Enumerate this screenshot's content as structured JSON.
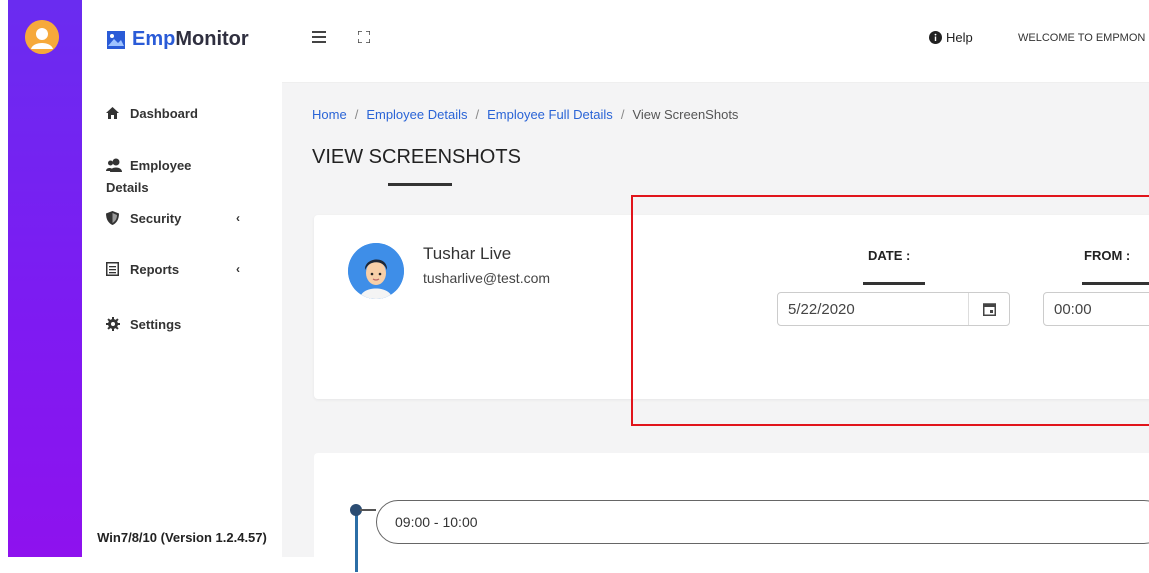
{
  "app": {
    "logo_part1": "Emp",
    "logo_part2": "Monitor"
  },
  "sidebar": {
    "items": [
      {
        "label": "Dashboard",
        "icon": "home-icon"
      },
      {
        "label_line1": "Employee",
        "label_line2": "Details",
        "icon": "users-icon"
      },
      {
        "label": "Security",
        "icon": "shield-icon",
        "chevron": "‹"
      },
      {
        "label": "Reports",
        "icon": "report-icon",
        "chevron": "‹"
      },
      {
        "label": "Settings",
        "icon": "gear-icon"
      }
    ],
    "version": "Win7/8/10 (Version 1.2.4.57)"
  },
  "topbar": {
    "help_label": "Help",
    "welcome_text": "WELCOME TO EMPMON"
  },
  "breadcrumb": {
    "items": [
      "Home",
      "Employee Details",
      "Employee Full Details"
    ],
    "current": "View ScreenShots",
    "separator": "/"
  },
  "page": {
    "title": "VIEW SCREENSHOTS"
  },
  "employee": {
    "name": "Tushar Live",
    "email": "tusharlive@test.com"
  },
  "filters": {
    "date_label": "DATE :",
    "date_value": "5/22/2020",
    "from_label": "FROM :",
    "from_value": "00:00"
  },
  "timeline": {
    "first_slot": "09:00 - 10:00"
  },
  "colors": {
    "accent": "#2a64d6",
    "rail_top": "#6a2cf0",
    "rail_bottom": "#8e12ee",
    "highlight": "#e1141b"
  }
}
